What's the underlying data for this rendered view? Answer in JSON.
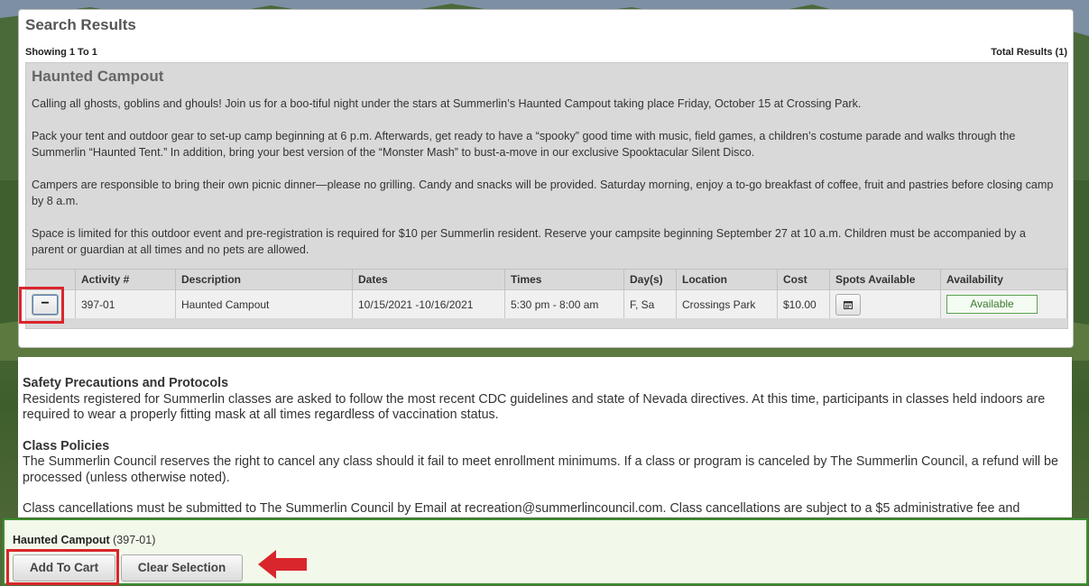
{
  "panel": {
    "title": "Search Results",
    "showing": "Showing 1 To 1",
    "total": "Total Results (1)"
  },
  "activity": {
    "title": "Haunted Campout",
    "paragraphs": [
      "Calling all ghosts, goblins and ghouls! Join us for a boo-tiful night under the stars at Summerlin’s Haunted Campout taking place Friday, October 15 at Crossing Park.",
      "Pack your tent and outdoor gear to set-up camp beginning at 6 p.m. Afterwards, get ready to have a “spooky” good time with music, field games, a children’s costume parade and walks through the Summerlin “Haunted Tent.” In addition, bring your best version of the “Monster Mash” to bust-a-move in our exclusive Spooktacular Silent Disco.",
      "Campers are responsible to bring their own picnic dinner—please no grilling. Candy and snacks will be provided. Saturday morning, enjoy a to-go breakfast of coffee, fruit and pastries before closing camp by 8 a.m.",
      "Space is limited for this outdoor event and pre-registration is required for $10 per Summerlin resident. Reserve your campsite beginning September 27 at 10 a.m. Children must be accompanied by a parent or guardian at all times and no pets are allowed."
    ]
  },
  "table": {
    "headers": [
      "",
      "Activity #",
      "Description",
      "Dates",
      "Times",
      "Day(s)",
      "Location",
      "Cost",
      "Spots Available",
      "Availability"
    ],
    "row": {
      "toggle": "−",
      "activity_no": "397-01",
      "description": "Haunted Campout",
      "dates": "10/15/2021 -10/16/2021",
      "times": "5:30 pm - 8:00 am",
      "days": "F, Sa",
      "location": "Crossings Park",
      "cost": "$10.00",
      "spots_icon": "calendar-icon",
      "availability": "Available"
    }
  },
  "policies": {
    "safety_title": "Safety Precautions and Protocols",
    "safety_text": "Residents registered for Summerlin classes are asked to follow the most recent CDC guidelines and state of Nevada directives. At this time, participants in classes held indoors are required to wear a properly fitting mask at all times regardless of vaccination status.",
    "class_title": "Class Policies",
    "class_text": "The Summerlin Council reserves the right to cancel any class should it fail to meet enrollment minimums. If a class or program is canceled by The Summerlin Council, a refund will be processed (unless otherwise noted).",
    "cancel_text": "Class cancellations must be submitted to The Summerlin Council by Email at recreation@summerlincouncil.com. Class cancellations are subject to a $5 administrative fee and"
  },
  "cart": {
    "selection_name": "Haunted Campout",
    "selection_code": "(397-01)",
    "add_label": "Add To Cart",
    "clear_label": "Clear Selection"
  },
  "colors": {
    "highlight": "#d9262c",
    "cart_border": "#3a8e2e",
    "available": "#3a7a2f"
  }
}
